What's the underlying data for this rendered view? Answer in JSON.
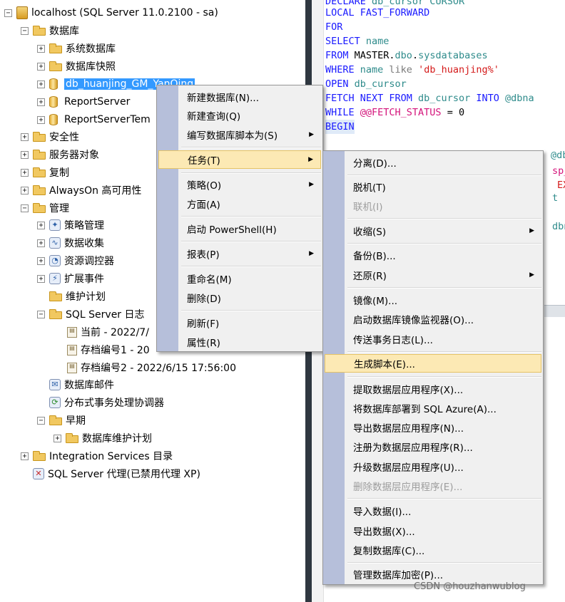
{
  "tree": {
    "root_label": "localhost (SQL Server 11.0.2100 - sa)",
    "databases": "数据库",
    "system_dbs": "系统数据库",
    "snapshots": "数据库快照",
    "selected_db": "db_huanjing_GM_YanQing",
    "report_server": "ReportServer",
    "report_server_temp": "ReportServerTem",
    "security": "安全性",
    "server_objects": "服务器对象",
    "replication": "复制",
    "alwayson": "AlwaysOn 高可用性",
    "management": "管理",
    "policy_mgmt": "策略管理",
    "data_collection": "数据收集",
    "resource_governor": "资源调控器",
    "extended_events": "扩展事件",
    "maintenance_plans": "维护计划",
    "sql_logs": "SQL Server 日志",
    "log_current": "当前 - 2022/7/",
    "log_archive1": "存档编号1 - 20",
    "log_archive2": "存档编号2 - 2022/6/15 17:56:00",
    "db_mail": "数据库邮件",
    "dtc": "分布式事务处理协调器",
    "legacy": "早期",
    "db_maint_plans": "数据库维护计划",
    "integration_services": "Integration Services 目录",
    "sql_agent": "SQL Server 代理(已禁用代理 XP)"
  },
  "menu1": {
    "new_db": "新建数据库(N)...",
    "new_query": "新建查询(Q)",
    "script_db": "编写数据库脚本为(S)",
    "tasks": "任务(T)",
    "policies": "策略(O)",
    "facets": "方面(A)",
    "powershell": "启动 PowerShell(H)",
    "reports": "报表(P)",
    "rename": "重命名(M)",
    "delete": "删除(D)",
    "refresh": "刷新(F)",
    "properties": "属性(R)"
  },
  "menu2": {
    "detach": "分离(D)...",
    "take_offline": "脱机(T)",
    "bring_online": "联机(I)",
    "shrink": "收缩(S)",
    "backup": "备份(B)...",
    "restore": "还原(R)",
    "mirror": "镜像(M)...",
    "mirror_monitor": "启动数据库镜像监视器(O)...",
    "log_shipping": "传送事务日志(L)...",
    "generate_scripts": "生成脚本(E)...",
    "extract_dac": "提取数据层应用程序(X)...",
    "deploy_azure": "将数据库部署到 SQL Azure(A)...",
    "export_dac": "导出数据层应用程序(N)...",
    "register_dac": "注册为数据层应用程序(R)...",
    "upgrade_dac": "升级数据层应用程序(U)...",
    "delete_dac": "删除数据层应用程序(E)...",
    "import_data": "导入数据(I)...",
    "export_data": "导出数据(X)...",
    "copy_db": "复制数据库(C)...",
    "encryption": "管理数据库加密(P)..."
  },
  "code": {
    "l0_kw": "DECLARE",
    "l0_rest": " db_cursor CURSOR",
    "l1": "LOCAL FAST_FORWARD",
    "l2": "FOR",
    "l3_kw": "SELECT",
    "l3_rest": " name",
    "l4_kw": "FROM",
    "l4_a": " MASTER.",
    "l4_b": "dbo",
    "l4_c": ".",
    "l4_d": "sysdatabases",
    "l5_kw": "WHERE",
    "l5_a": " name ",
    "l5_b": "like",
    "l5_c": " ",
    "l5_str": "'db_huanjing%'",
    "l6_kw": "OPEN",
    "l6_rest": " db_cursor",
    "l7_kw": "FETCH NEXT FROM",
    "l7_rest": " db_cursor ",
    "l7_kw2": "INTO",
    "l7_var": " @dbna",
    "l8_kw": "WHILE",
    "l8_fn": " @@FETCH_STATUS",
    "l8_rest": " = 0",
    "l9": "BEGIN",
    "f1": "@dbn",
    "f2": "sp_",
    "f3": "EXE",
    "f4": "t",
    "f5": "dbn"
  },
  "watermark": "CSDN @houzhanwublog"
}
